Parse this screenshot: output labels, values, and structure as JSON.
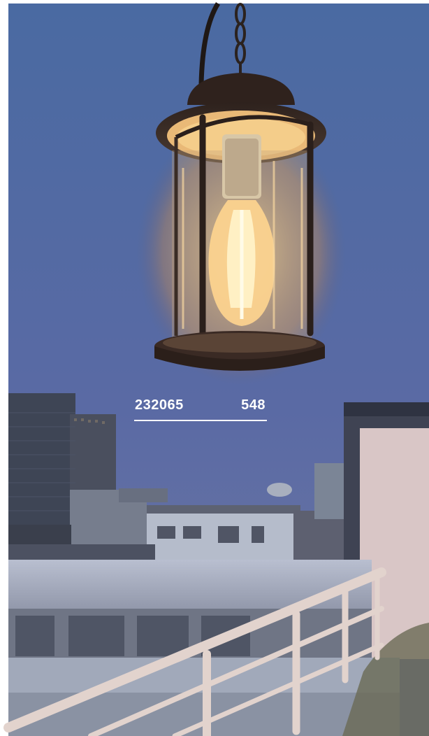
{
  "label": {
    "product_code": "232065",
    "page_number": "548"
  },
  "colors": {
    "sky_top": "#4d6fa6",
    "sky_bottom": "#5d6ea3",
    "lamp_glow": "#ffcc77",
    "lamp_body": "#3b2c26",
    "railing": "#dfd2cd",
    "building": "#9aa5b8"
  }
}
